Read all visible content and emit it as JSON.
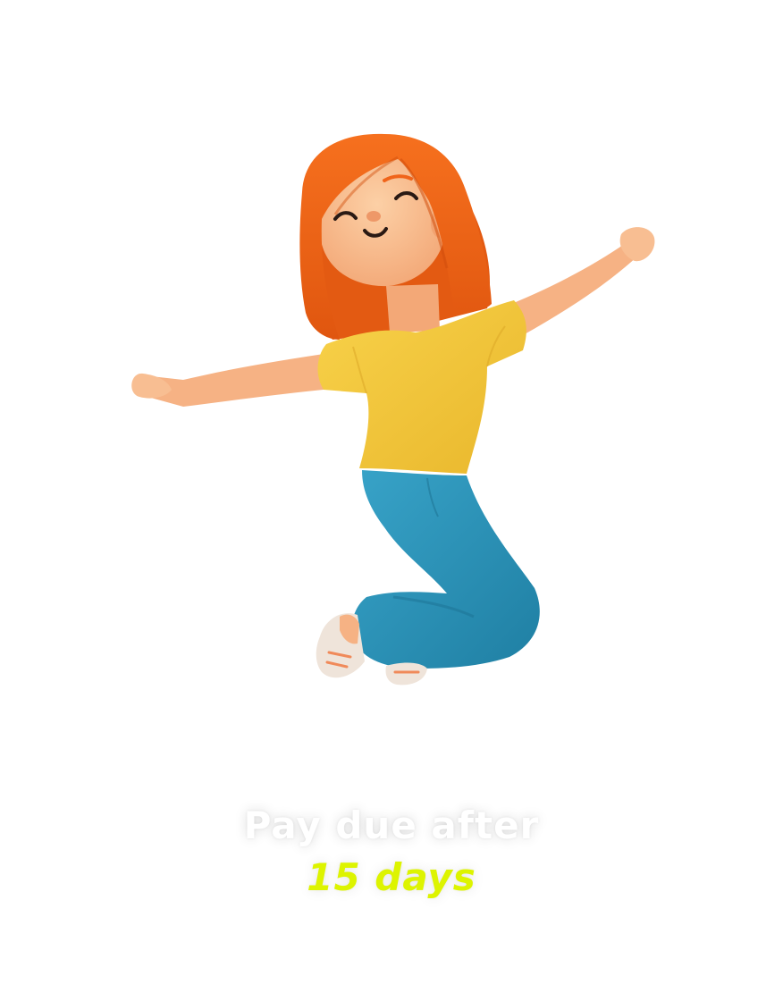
{
  "caption": {
    "line1": "Pay due after",
    "line2": "15 days"
  },
  "illustration": {
    "name": "jumping-girl-illustration"
  },
  "colors": {
    "background": "#ffffff",
    "hair": "#f0641a",
    "skin": "#f9b98a",
    "shirt": "#f6c73c",
    "pants": "#2a92b8",
    "shoes": "#efe4da",
    "accent": "#ddf400"
  }
}
